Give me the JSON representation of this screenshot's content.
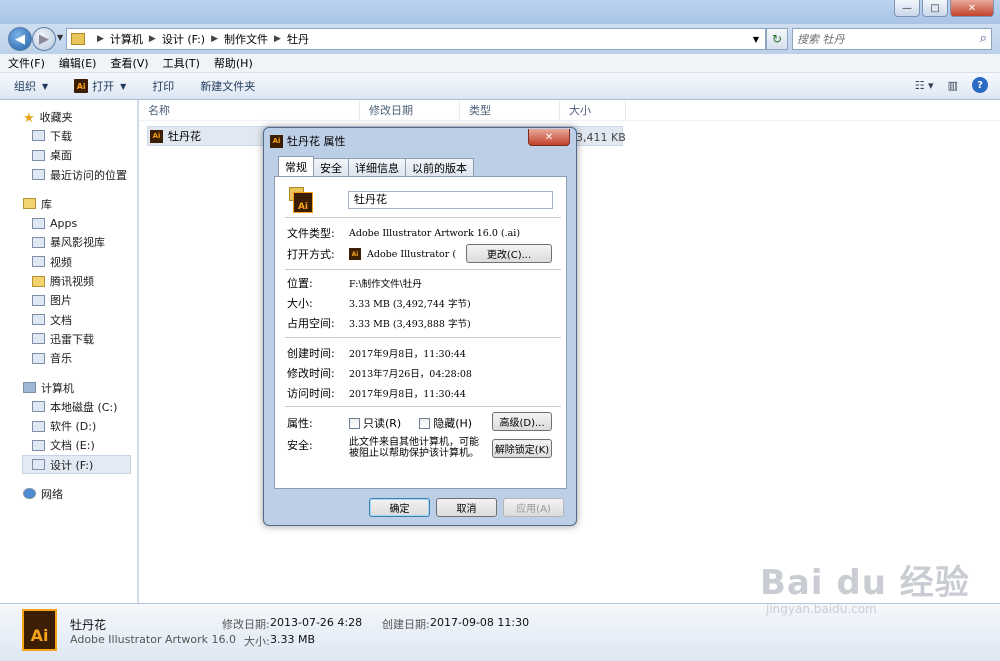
{
  "window": {
    "minimize": "—",
    "maximize": "□",
    "close": "✕"
  },
  "address": {
    "crumbs": [
      "计算机",
      "设计 (F:)",
      "制作文件",
      "牡丹"
    ]
  },
  "search": {
    "placeholder": "搜索 牡丹"
  },
  "menu": [
    "文件(F)",
    "编辑(E)",
    "查看(V)",
    "工具(T)",
    "帮助(H)"
  ],
  "toolbar": {
    "organize": "组织",
    "open": "打开",
    "print": "打印",
    "new_folder": "新建文件夹"
  },
  "nav": {
    "favorites": {
      "title": "收藏夹",
      "items": [
        "下载",
        "桌面",
        "最近访问的位置"
      ]
    },
    "libraries": {
      "title": "库",
      "items": [
        "Apps",
        "暴风影视库",
        "视频",
        "腾讯视频",
        "图片",
        "文档",
        "迅雷下载",
        "音乐"
      ]
    },
    "computer": {
      "title": "计算机",
      "items": [
        "本地磁盘 (C:)",
        "软件 (D:)",
        "文档 (E:)",
        "设计 (F:)"
      ],
      "selected": "设计 (F:)"
    },
    "network": {
      "title": "网络"
    }
  },
  "columns": [
    "名称",
    "修改日期",
    "类型",
    "大小"
  ],
  "files": [
    {
      "name": "牡丹花",
      "size": "3,411 KB"
    }
  ],
  "details": {
    "name": "牡丹花",
    "type": "Adobe Illustrator Artwork 16.0",
    "modified_label": "修改日期:",
    "modified": "2013-07-26 4:28",
    "created_label": "创建日期:",
    "created": "2017-09-08 11:30",
    "size_label": "大小:",
    "size": "3.33 MB"
  },
  "dialog": {
    "title": "牡丹花 属性",
    "tabs": [
      "常规",
      "安全",
      "详细信息",
      "以前的版本"
    ],
    "active_tab": "常规",
    "filename": "牡丹花",
    "file_type_label": "文件类型:",
    "file_type": "Adobe Illustrator Artwork 16.0 (.ai)",
    "opens_with_label": "打开方式:",
    "opens_with": "Adobe Illustrator (",
    "change_button": "更改(C)...",
    "location_label": "位置:",
    "location": "F:\\制作文件\\牡丹",
    "size_label": "大小:",
    "size": "3.33 MB (3,492,744 字节)",
    "disk_label": "占用空间:",
    "disk": "3.33 MB (3,493,888 字节)",
    "created_label": "创建时间:",
    "created": "2017年9月8日，11:30:44",
    "modified_label": "修改时间:",
    "modified": "2013年7月26日，04:28:08",
    "accessed_label": "访问时间:",
    "accessed": "2017年9月8日，11:30:44",
    "attributes_label": "属性:",
    "readonly": "只读(R)",
    "hidden": "隐藏(H)",
    "advanced_button": "高级(D)...",
    "security_label": "安全:",
    "security_text_1": "此文件来自其他计算机，可能",
    "security_text_2": "被阻止以帮助保护该计算机。",
    "unblock_button": "解除锁定(K)",
    "ok": "确定",
    "cancel": "取消",
    "apply": "应用(A)"
  },
  "watermark": {
    "text": "Bai du 经验",
    "url": "jingyan.baidu.com"
  }
}
